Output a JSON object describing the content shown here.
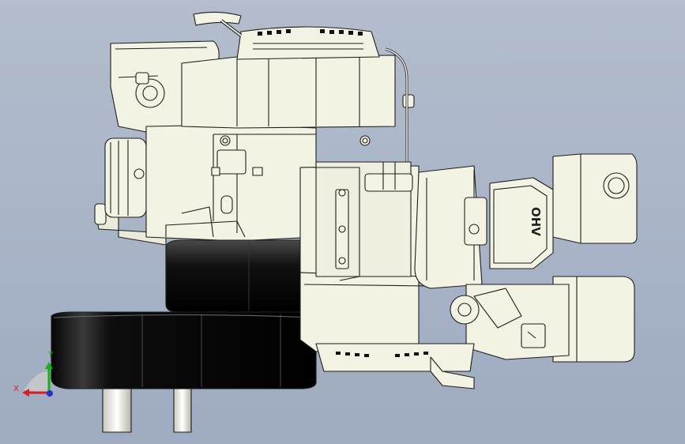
{
  "viewport": {
    "background_top": "#b3bdcd",
    "background_bottom": "#9eabc0"
  },
  "model": {
    "embossed_text": "OHV",
    "body_color": "#f3f3e4",
    "outline_color": "#1e1e1e",
    "rubber_color": "#111111"
  },
  "triad": {
    "x_label": "X",
    "y_label": "Y",
    "x_color": "#d42020",
    "y_color": "#16b116",
    "z_color": "#2233cc"
  }
}
